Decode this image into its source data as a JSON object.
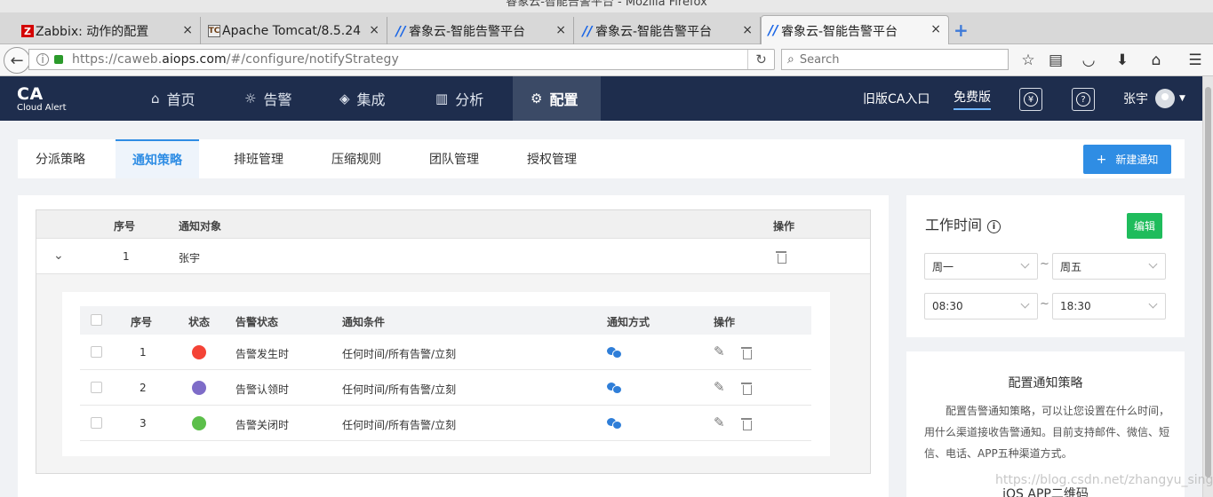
{
  "browser": {
    "window_title": "睿象云-智能告警平台 - Mozilla Firefox",
    "tabs": [
      {
        "label": "Zabbix: 动作的配置",
        "favicon": "Z"
      },
      {
        "label": "Apache Tomcat/8.5.24",
        "favicon": "TC"
      },
      {
        "label": "睿象云-智能告警平台",
        "favicon": "ca"
      },
      {
        "label": "睿象云-智能告警平台",
        "favicon": "ca"
      },
      {
        "label": "睿象云-智能告警平台",
        "favicon": "ca"
      }
    ],
    "close_glyph": "×",
    "new_tab_glyph": "+",
    "url_prefix": "https://caweb.",
    "url_domain": "aiops.com",
    "url_path": "/#/configure/notifyStrategy",
    "search_placeholder": "Search"
  },
  "header": {
    "logo_main": "CA",
    "logo_sub": "Cloud Alert",
    "nav": [
      {
        "label": "首页",
        "icon": "home-icon"
      },
      {
        "label": "告警",
        "icon": "alarm-icon"
      },
      {
        "label": "集成",
        "icon": "layers-icon"
      },
      {
        "label": "分析",
        "icon": "chart-icon"
      },
      {
        "label": "配置",
        "icon": "gear-icon",
        "active": true
      }
    ],
    "old_entry": "旧版CA入口",
    "free_version": "免费版",
    "user_name": "张宇"
  },
  "subtabs": {
    "items": [
      "分派策略",
      "通知策略",
      "排班管理",
      "压缩规则",
      "团队管理",
      "授权管理"
    ],
    "active": "通知策略",
    "new_button": "新建通知",
    "new_button_icon": "+"
  },
  "main": {
    "outer_headers": {
      "index": "序号",
      "target": "通知对象",
      "action": "操作"
    },
    "outer_row": {
      "index": "1",
      "target": "张宇"
    },
    "inner_headers": {
      "index": "序号",
      "status": "状态",
      "alert_state": "告警状态",
      "condition": "通知条件",
      "method": "通知方式",
      "action": "操作"
    },
    "inner_rows": [
      {
        "index": "1",
        "status_color": "#f44336",
        "alert_state": "告警发生时",
        "condition": "任何时间/所有告警/立刻",
        "method": "wechat-icon"
      },
      {
        "index": "2",
        "status_color": "#7e6cc8",
        "alert_state": "告警认领时",
        "condition": "任何时间/所有告警/立刻",
        "method": "wechat-icon"
      },
      {
        "index": "3",
        "status_color": "#5cbf4a",
        "alert_state": "告警关闭时",
        "condition": "任何时间/所有告警/立刻",
        "method": "wechat-icon"
      }
    ]
  },
  "worktime": {
    "title": "工作时间",
    "edit_button": "编辑",
    "day_from": "周一",
    "day_to": "周五",
    "time_from": "08:30",
    "time_to": "18:30",
    "separator": "~"
  },
  "config_panel": {
    "title": "配置通知策略",
    "description": "配置告警通知策略，可以让您设置在什么时间，用什么渠道接收告警通知。目前支持邮件、微信、短信、电话、APP五种渠道方式。",
    "ios_title": "iOS APP二维码"
  },
  "watermark": "https://blog.csdn.net/zhangyu_sing",
  "colors": {
    "header_bg": "#1e2d4d",
    "accent": "#2f8de4",
    "edit_green": "#1fbc5c"
  }
}
